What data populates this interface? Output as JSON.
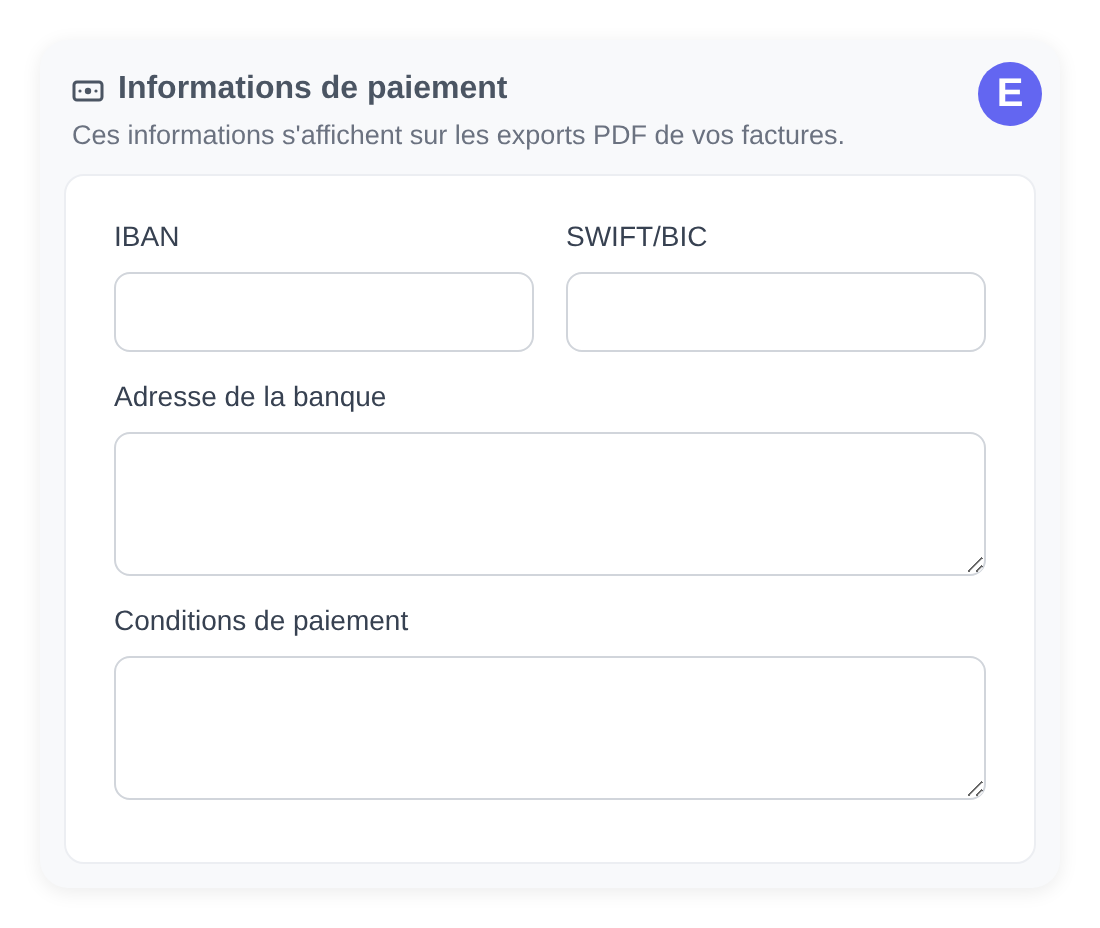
{
  "section": {
    "title": "Informations de paiement",
    "subtitle": "Ces informations s'affichent sur les exports PDF de vos factures.",
    "badge": "E"
  },
  "rows": [
    {
      "fields": [
        {
          "label": "IBAN",
          "kind": "input"
        },
        {
          "label": "SWIFT/BIC",
          "kind": "input"
        }
      ]
    },
    {
      "fields": [
        {
          "label": "Adresse de la banque",
          "kind": "textarea"
        }
      ]
    },
    {
      "fields": [
        {
          "label": "Conditions de paiement",
          "kind": "textarea"
        }
      ]
    }
  ]
}
